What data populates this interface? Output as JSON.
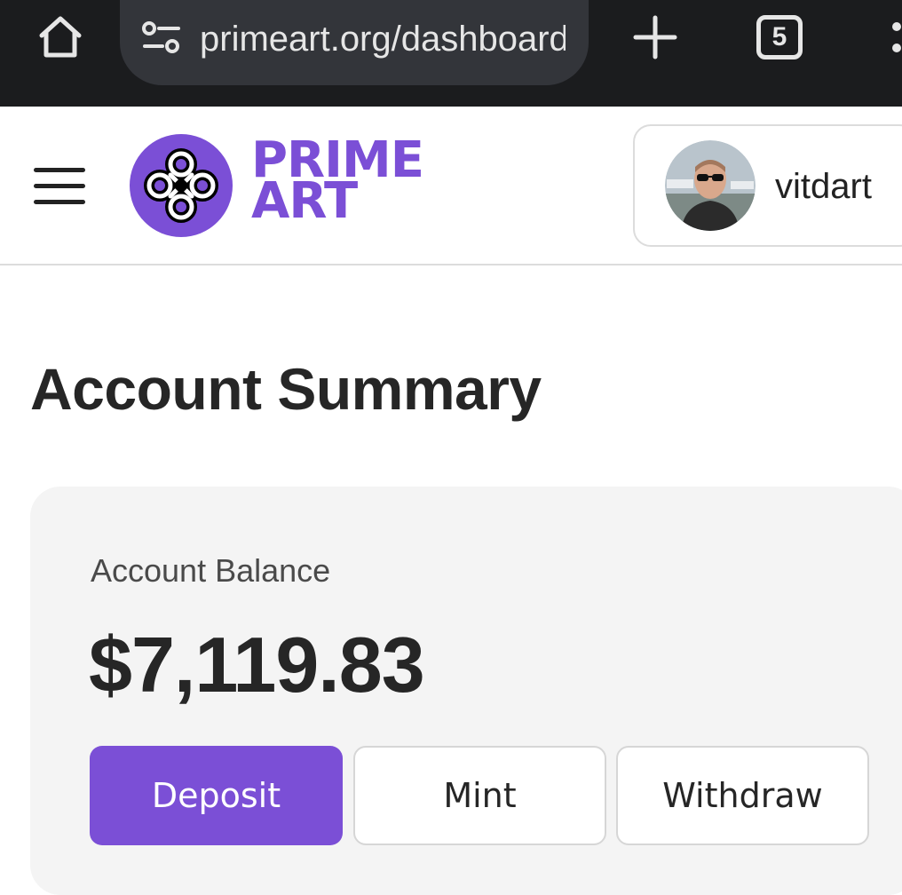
{
  "browser": {
    "url": "primeart.org/dashboard",
    "tab_count": "5",
    "icons": [
      "home-icon",
      "site-settings-icon",
      "plus-icon",
      "tabs-icon",
      "more-vert-icon"
    ]
  },
  "header": {
    "logo_line1": "PRIME",
    "logo_line2": "ART",
    "username": "vitdart"
  },
  "main": {
    "title": "Account Summary",
    "balance_label": "Account Balance",
    "balance_value": "$7,119.83",
    "buttons": {
      "deposit": "Deposit",
      "mint": "Mint",
      "withdraw": "Withdraw"
    }
  },
  "colors": {
    "brand": "#7b4fd6",
    "browser_bar": "#1b1c1e",
    "card_bg": "#f4f4f4"
  }
}
